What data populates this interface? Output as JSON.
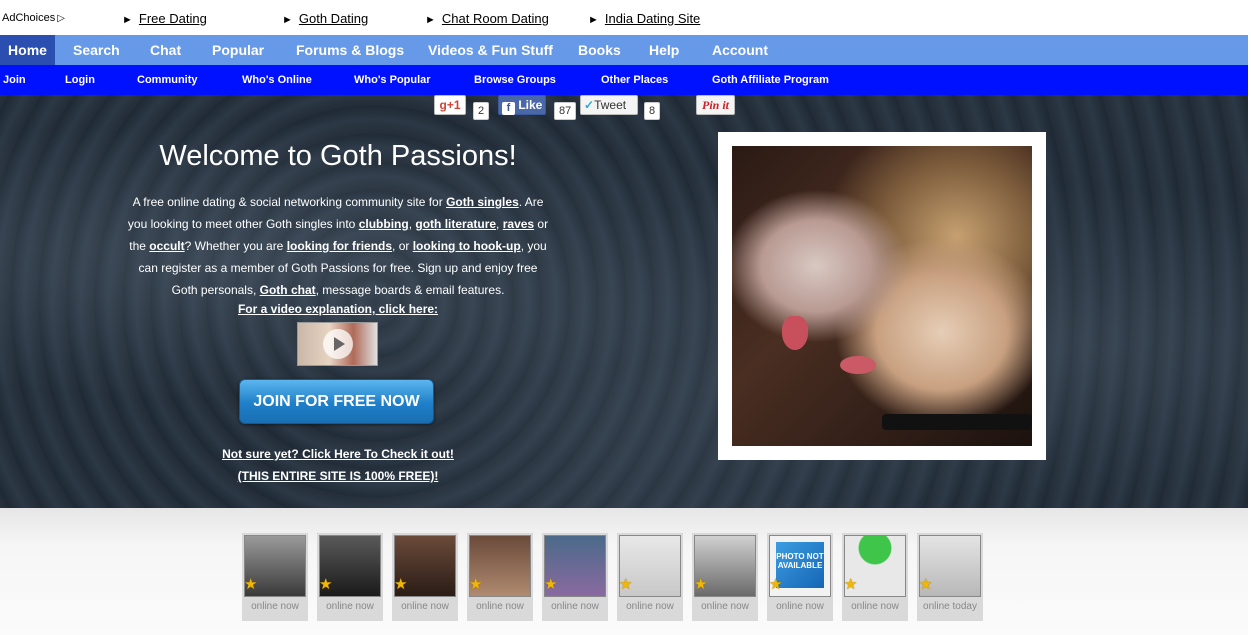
{
  "ad_bar": {
    "adchoices": "AdChoices",
    "links": [
      "Free Dating",
      "Goth Dating",
      "Chat Room Dating",
      "India Dating Site"
    ]
  },
  "main_nav": [
    "Home",
    "Search",
    "Chat",
    "Popular",
    "Forums & Blogs",
    "Videos & Fun Stuff",
    "Books",
    "Help",
    "Account"
  ],
  "sub_nav": [
    "Join",
    "Login",
    "Community",
    "Who's Online",
    "Who's Popular",
    "Browse Groups",
    "Other Places",
    "Goth Affiliate Program"
  ],
  "social": {
    "gplus_label": "+1",
    "gplus_count": "2",
    "like_label": "Like",
    "like_count": "87",
    "tweet_label": "Tweet",
    "tweet_count": "8",
    "pinit_label": "Pin it"
  },
  "hero": {
    "title": "Welcome to Goth Passions!",
    "intro_parts": {
      "p1": "A free online dating & social networking community site for ",
      "l1": "Goth singles",
      "p2": ". Are you looking to meet other Goth singles into ",
      "l2": "clubbing",
      "p3": ", ",
      "l3": "goth literature",
      "p4": ", ",
      "l4": "raves",
      "p5": " or the ",
      "l5": "occult",
      "p6": "? Whether you are ",
      "l6": "looking for friends",
      "p7": ", or ",
      "l7": "looking to hook-up",
      "p8": ", you can register as a member of Goth Passions for free. Sign up and enjoy free Goth personals, ",
      "l8": "Goth chat",
      "p9": ", message boards & email features."
    },
    "video_link": "For a video explanation, click here:",
    "join_button": "JOIN FOR FREE NOW",
    "not_sure": "Not sure yet? Click Here To Check it out!",
    "free_note": "(THIS ENTIRE SITE IS 100% FREE)!"
  },
  "members": [
    {
      "status": "online now"
    },
    {
      "status": "online now"
    },
    {
      "status": "online now"
    },
    {
      "status": "online now"
    },
    {
      "status": "online now"
    },
    {
      "status": "online now"
    },
    {
      "status": "online now"
    },
    {
      "status": "online now",
      "placeholder": "PHOTO NOT AVAILABLE"
    },
    {
      "status": "online now"
    },
    {
      "status": "online today"
    }
  ],
  "colors": {
    "main_nav_bg": "#6699e8",
    "home_tab_bg": "#2a4fb0",
    "sub_nav_bg": "#0011ff",
    "join_button": "#1e7fc8"
  }
}
